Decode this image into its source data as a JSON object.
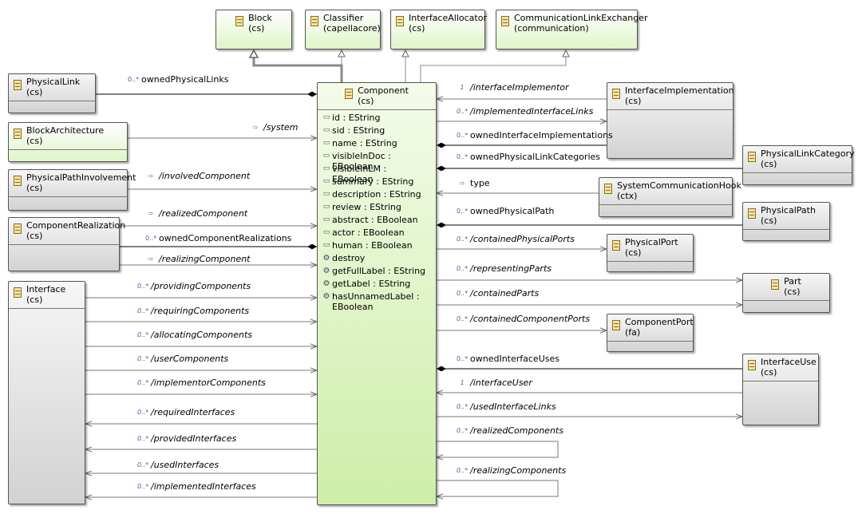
{
  "classes": {
    "block": {
      "name": "Block",
      "pkg": "(cs)"
    },
    "classifier": {
      "name": "Classifier",
      "pkg": "(capellacore)"
    },
    "interfaceAllocator": {
      "name": "InterfaceAllocator",
      "pkg": "(cs)"
    },
    "commExchanger": {
      "name": "CommunicationLinkExchanger",
      "pkg": "(communication)"
    },
    "physicalLink": {
      "name": "PhysicalLink",
      "pkg": "(cs)"
    },
    "blockArchitecture": {
      "name": "BlockArchitecture",
      "pkg": "(cs)"
    },
    "physicalPathInvolvement": {
      "name": "PhysicalPathInvolvement",
      "pkg": "(cs)"
    },
    "componentRealization": {
      "name": "ComponentRealization",
      "pkg": "(cs)"
    },
    "interface": {
      "name": "Interface",
      "pkg": "(cs)"
    },
    "component": {
      "name": "Component",
      "pkg": "(cs)"
    },
    "interfaceImplementation": {
      "name": "InterfaceImplementation",
      "pkg": "(cs)"
    },
    "physicalLinkCategory": {
      "name": "PhysicalLinkCategory",
      "pkg": "(cs)"
    },
    "systemCommunicationHook": {
      "name": "SystemCommunicationHook",
      "pkg": "(ctx)"
    },
    "physicalPath": {
      "name": "PhysicalPath",
      "pkg": "(cs)"
    },
    "physicalPort": {
      "name": "PhysicalPort",
      "pkg": "(cs)"
    },
    "part": {
      "name": "Part",
      "pkg": "(cs)"
    },
    "componentPort": {
      "name": "ComponentPort",
      "pkg": "(fa)"
    },
    "interfaceUse": {
      "name": "InterfaceUse",
      "pkg": "(cs)"
    }
  },
  "component_features": [
    {
      "kind": "attr",
      "text": "id : EString"
    },
    {
      "kind": "prop",
      "text": "sid : EString"
    },
    {
      "kind": "prop",
      "text": "name : EString"
    },
    {
      "kind": "prop",
      "text": "visibleInDoc : EBoolean"
    },
    {
      "kind": "prop",
      "text": "visibleInLM : EBoolean"
    },
    {
      "kind": "prop",
      "text": "summary : EString"
    },
    {
      "kind": "prop",
      "text": "description : EString"
    },
    {
      "kind": "prop",
      "text": "review : EString"
    },
    {
      "kind": "prop",
      "text": "abstract : EBoolean"
    },
    {
      "kind": "prop",
      "text": "actor : EBoolean"
    },
    {
      "kind": "attr",
      "text": "human : EBoolean"
    },
    {
      "kind": "op",
      "text": "destroy"
    },
    {
      "kind": "op",
      "text": "getFullLabel : EString"
    },
    {
      "kind": "op",
      "text": "getLabel : EString"
    },
    {
      "kind": "op",
      "text": "hasUnnamedLabel : EBoolean"
    }
  ],
  "edge_labels": {
    "ownedPhysicalLinks": "ownedPhysicalLinks",
    "system": "/system",
    "involvedComponent": "/involvedComponent",
    "realizedComponent": "/realizedComponent",
    "ownedComponentRealizations": "ownedComponentRealizations",
    "realizingComponent": "/realizingComponent",
    "providingComponents": "/providingComponents",
    "requiringComponents": "/requiringComponents",
    "allocatingComponents": "/allocatingComponents",
    "userComponents": "/userComponents",
    "implementorComponents": "/implementorComponents",
    "requiredInterfaces": "/requiredInterfaces",
    "providedInterfaces": "/providedInterfaces",
    "usedInterfaces": "/usedInterfaces",
    "implementedInterfaces": "/implementedInterfaces",
    "interfaceImplementor": "/interfaceImplementor",
    "implementedInterfaceLinks": "/implementedInterfaceLinks",
    "ownedInterfaceImplementations": "ownedInterfaceImplementations",
    "ownedPhysicalLinkCategories": "ownedPhysicalLinkCategories",
    "type": "type",
    "ownedPhysicalPath": "ownedPhysicalPath",
    "containedPhysicalPorts": "/containedPhysicalPorts",
    "representingParts": "/representingParts",
    "containedParts": "/containedParts",
    "containedComponentPorts": "/containedComponentPorts",
    "ownedInterfaceUses": "ownedInterfaceUses",
    "interfaceUser": "/interfaceUser",
    "usedInterfaceLinks": "/usedInterfaceLinks",
    "realizedComponents": "/realizedComponents",
    "realizingComponents": "/realizingComponents"
  },
  "multiplicity_icons": {
    "many": "0..*",
    "one": "1"
  }
}
